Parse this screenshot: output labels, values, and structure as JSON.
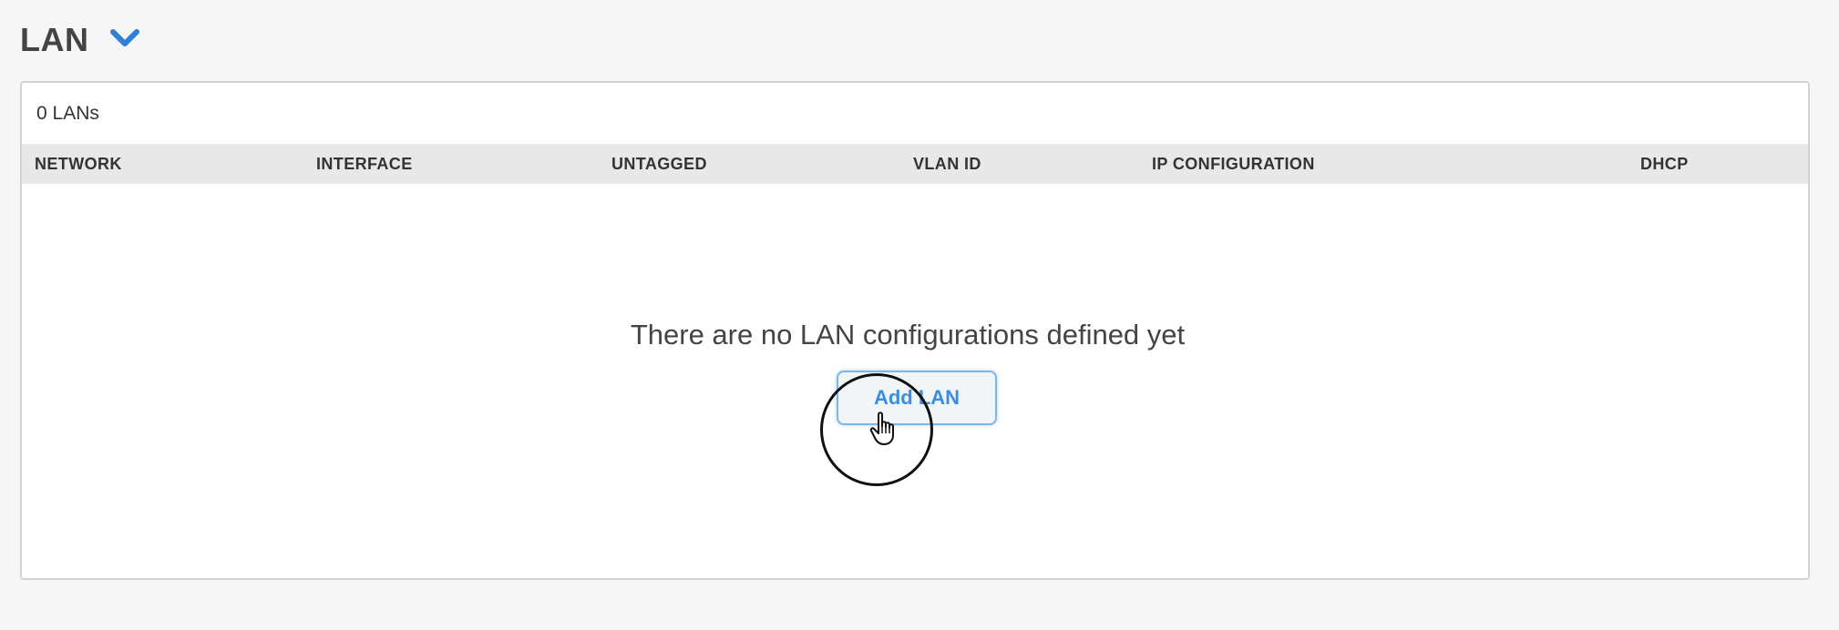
{
  "section": {
    "title": "LAN",
    "toggle_icon": "chevron-down-icon",
    "accent_color": "#2e7fd6"
  },
  "table": {
    "count_label": "0 LANs",
    "columns": [
      {
        "label": "NETWORK"
      },
      {
        "label": "INTERFACE"
      },
      {
        "label": "UNTAGGED"
      },
      {
        "label": "VLAN ID"
      },
      {
        "label": "IP CONFIGURATION"
      },
      {
        "label": "DHCP"
      }
    ]
  },
  "empty_state": {
    "message": "There are no LAN configurations defined yet",
    "add_button_label": "Add LAN",
    "button_color": "#3a8ee0"
  },
  "cursor": {
    "icon": "hand-pointer-icon"
  }
}
